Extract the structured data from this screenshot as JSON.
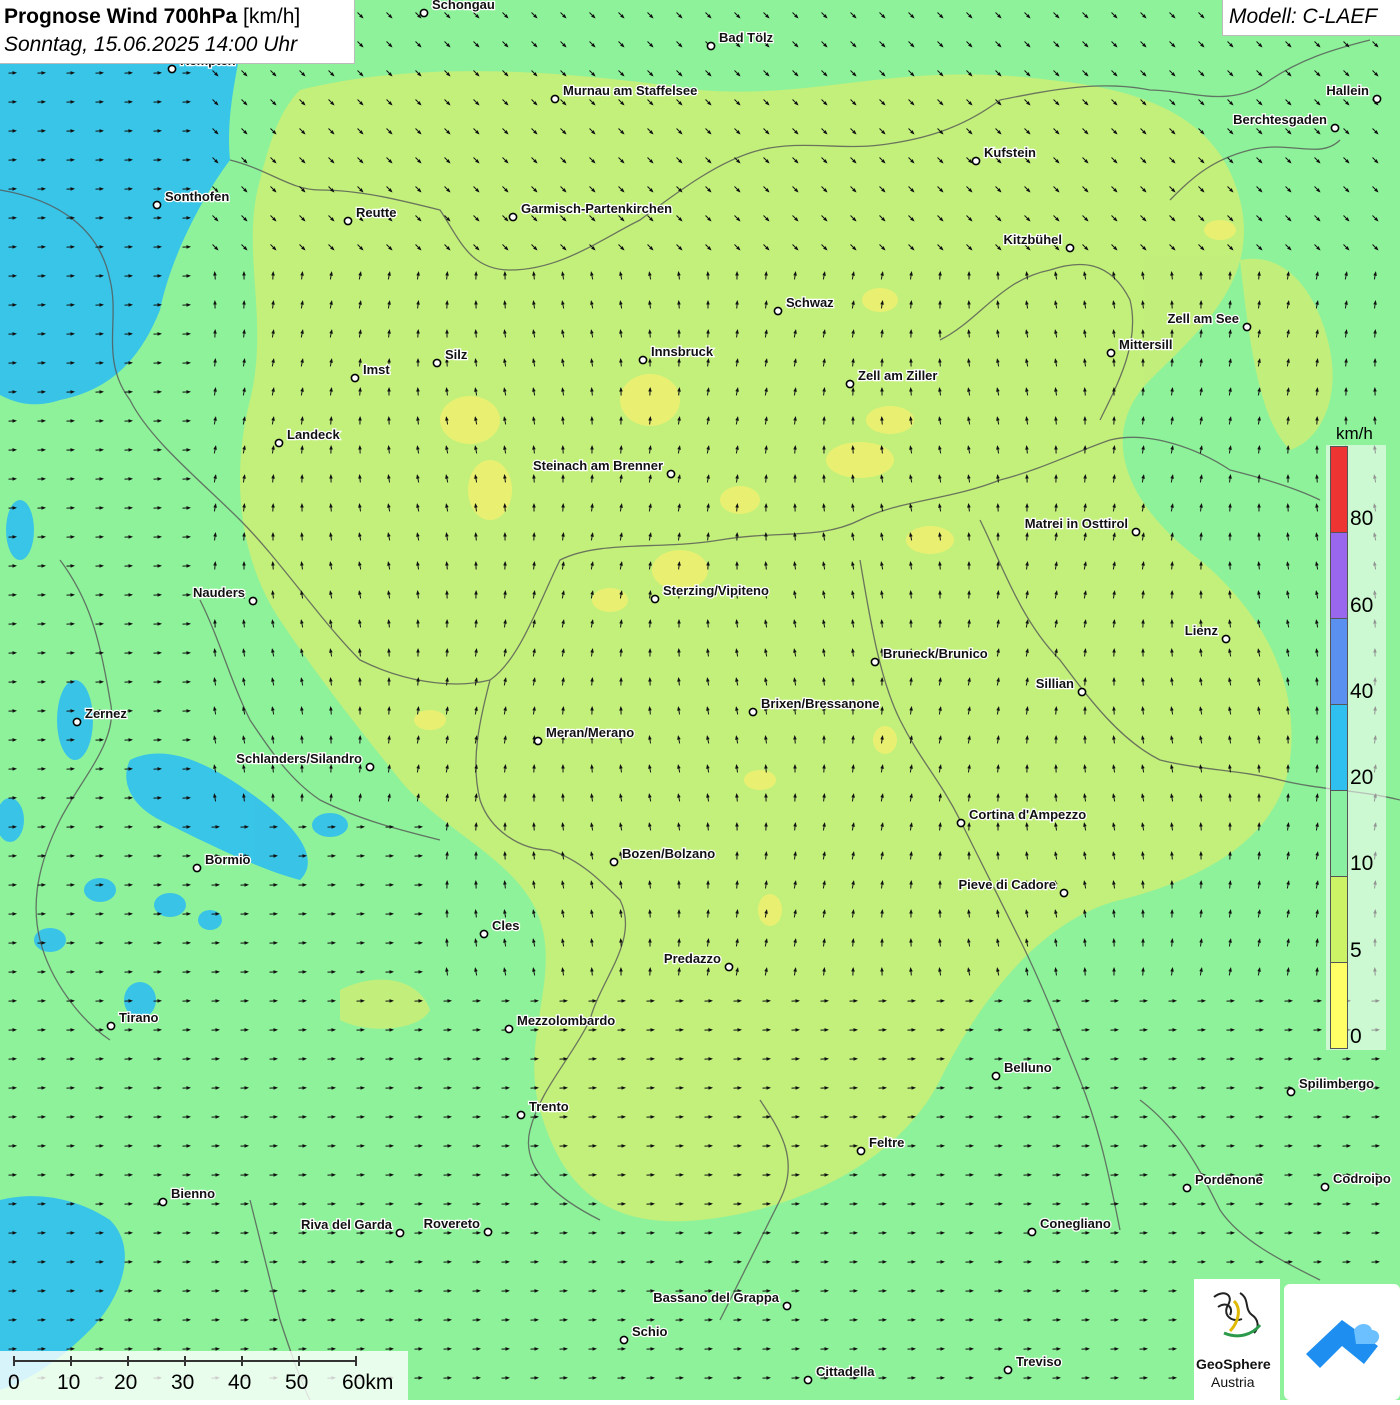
{
  "header": {
    "title_bold": "Prognose Wind 700hPa",
    "title_unit": "[km/h]",
    "date": "Sonntag, 15.06.2025 14:00 Uhr"
  },
  "model": "Modell: C-LAEF",
  "legend": {
    "unit": "km/h",
    "bands": [
      {
        "from": 0,
        "to": 5,
        "color": "#ffff66"
      },
      {
        "from": 5,
        "to": 10,
        "color": "#ccf266"
      },
      {
        "from": 10,
        "to": 20,
        "color": "#88f0a0"
      },
      {
        "from": 20,
        "to": 40,
        "color": "#30c0f0"
      },
      {
        "from": 40,
        "to": 60,
        "color": "#5a90f0"
      },
      {
        "from": 60,
        "to": 80,
        "color": "#9966ee"
      },
      {
        "from": 80,
        "to": 100,
        "color": "#ee3333"
      }
    ],
    "labels": [
      "80",
      "60",
      "40",
      "20",
      "10",
      "5",
      "0"
    ]
  },
  "scalebar": {
    "labels": [
      "0",
      "10",
      "20",
      "30",
      "40",
      "50",
      "60km"
    ]
  },
  "logos": {
    "geosphere_line1": "GeoSphere",
    "geosphere_line2": "Austria"
  },
  "map_colors": {
    "background": "#8ef29a",
    "low_wind": "#c8ef78",
    "very_low_wind": "#f0f070",
    "high_wind": "#30c0f0",
    "border": "#555555"
  },
  "cities": [
    {
      "name": "Schongau"
    },
    {
      "name": "Bad Tölz"
    },
    {
      "name": "Kempten"
    },
    {
      "name": "Murnau am Staffelsee"
    },
    {
      "name": "Hallein"
    },
    {
      "name": "Berchtesgaden"
    },
    {
      "name": "Kufstein"
    },
    {
      "name": "Sonthofen"
    },
    {
      "name": "Reutte"
    },
    {
      "name": "Garmisch-Partenkirchen"
    },
    {
      "name": "Kitzbühel"
    },
    {
      "name": "Schwaz"
    },
    {
      "name": "Zell am See"
    },
    {
      "name": "Mittersill"
    },
    {
      "name": "Innsbruck"
    },
    {
      "name": "Silz"
    },
    {
      "name": "Imst"
    },
    {
      "name": "Zell am Ziller"
    },
    {
      "name": "Landeck"
    },
    {
      "name": "Steinach am Brenner"
    },
    {
      "name": "Matrei in Osttirol"
    },
    {
      "name": "Nauders"
    },
    {
      "name": "Sterzing/Vipiteno"
    },
    {
      "name": "Lienz"
    },
    {
      "name": "Bruneck/Brunico"
    },
    {
      "name": "Sillian"
    },
    {
      "name": "Zernez"
    },
    {
      "name": "Brixen/Bressanone"
    },
    {
      "name": "Meran/Merano"
    },
    {
      "name": "Schlanders/Silandro"
    },
    {
      "name": "Cortina d'Ampezzo"
    },
    {
      "name": "Bozen/Bolzano"
    },
    {
      "name": "Bormio"
    },
    {
      "name": "Pieve di Cadore"
    },
    {
      "name": "Cles"
    },
    {
      "name": "Predazzo"
    },
    {
      "name": "Tirano"
    },
    {
      "name": "Mezzolombardo"
    },
    {
      "name": "Belluno"
    },
    {
      "name": "Spilimbergo"
    },
    {
      "name": "Trento"
    },
    {
      "name": "Feltre"
    },
    {
      "name": "Pordenone"
    },
    {
      "name": "Codroipo"
    },
    {
      "name": "Bienno"
    },
    {
      "name": "Riva del Garda"
    },
    {
      "name": "Rovereto"
    },
    {
      "name": "Conegliano"
    },
    {
      "name": "Bassano del Grappa"
    },
    {
      "name": "Schio"
    },
    {
      "name": "Treviso"
    },
    {
      "name": "Cittadella"
    }
  ]
}
